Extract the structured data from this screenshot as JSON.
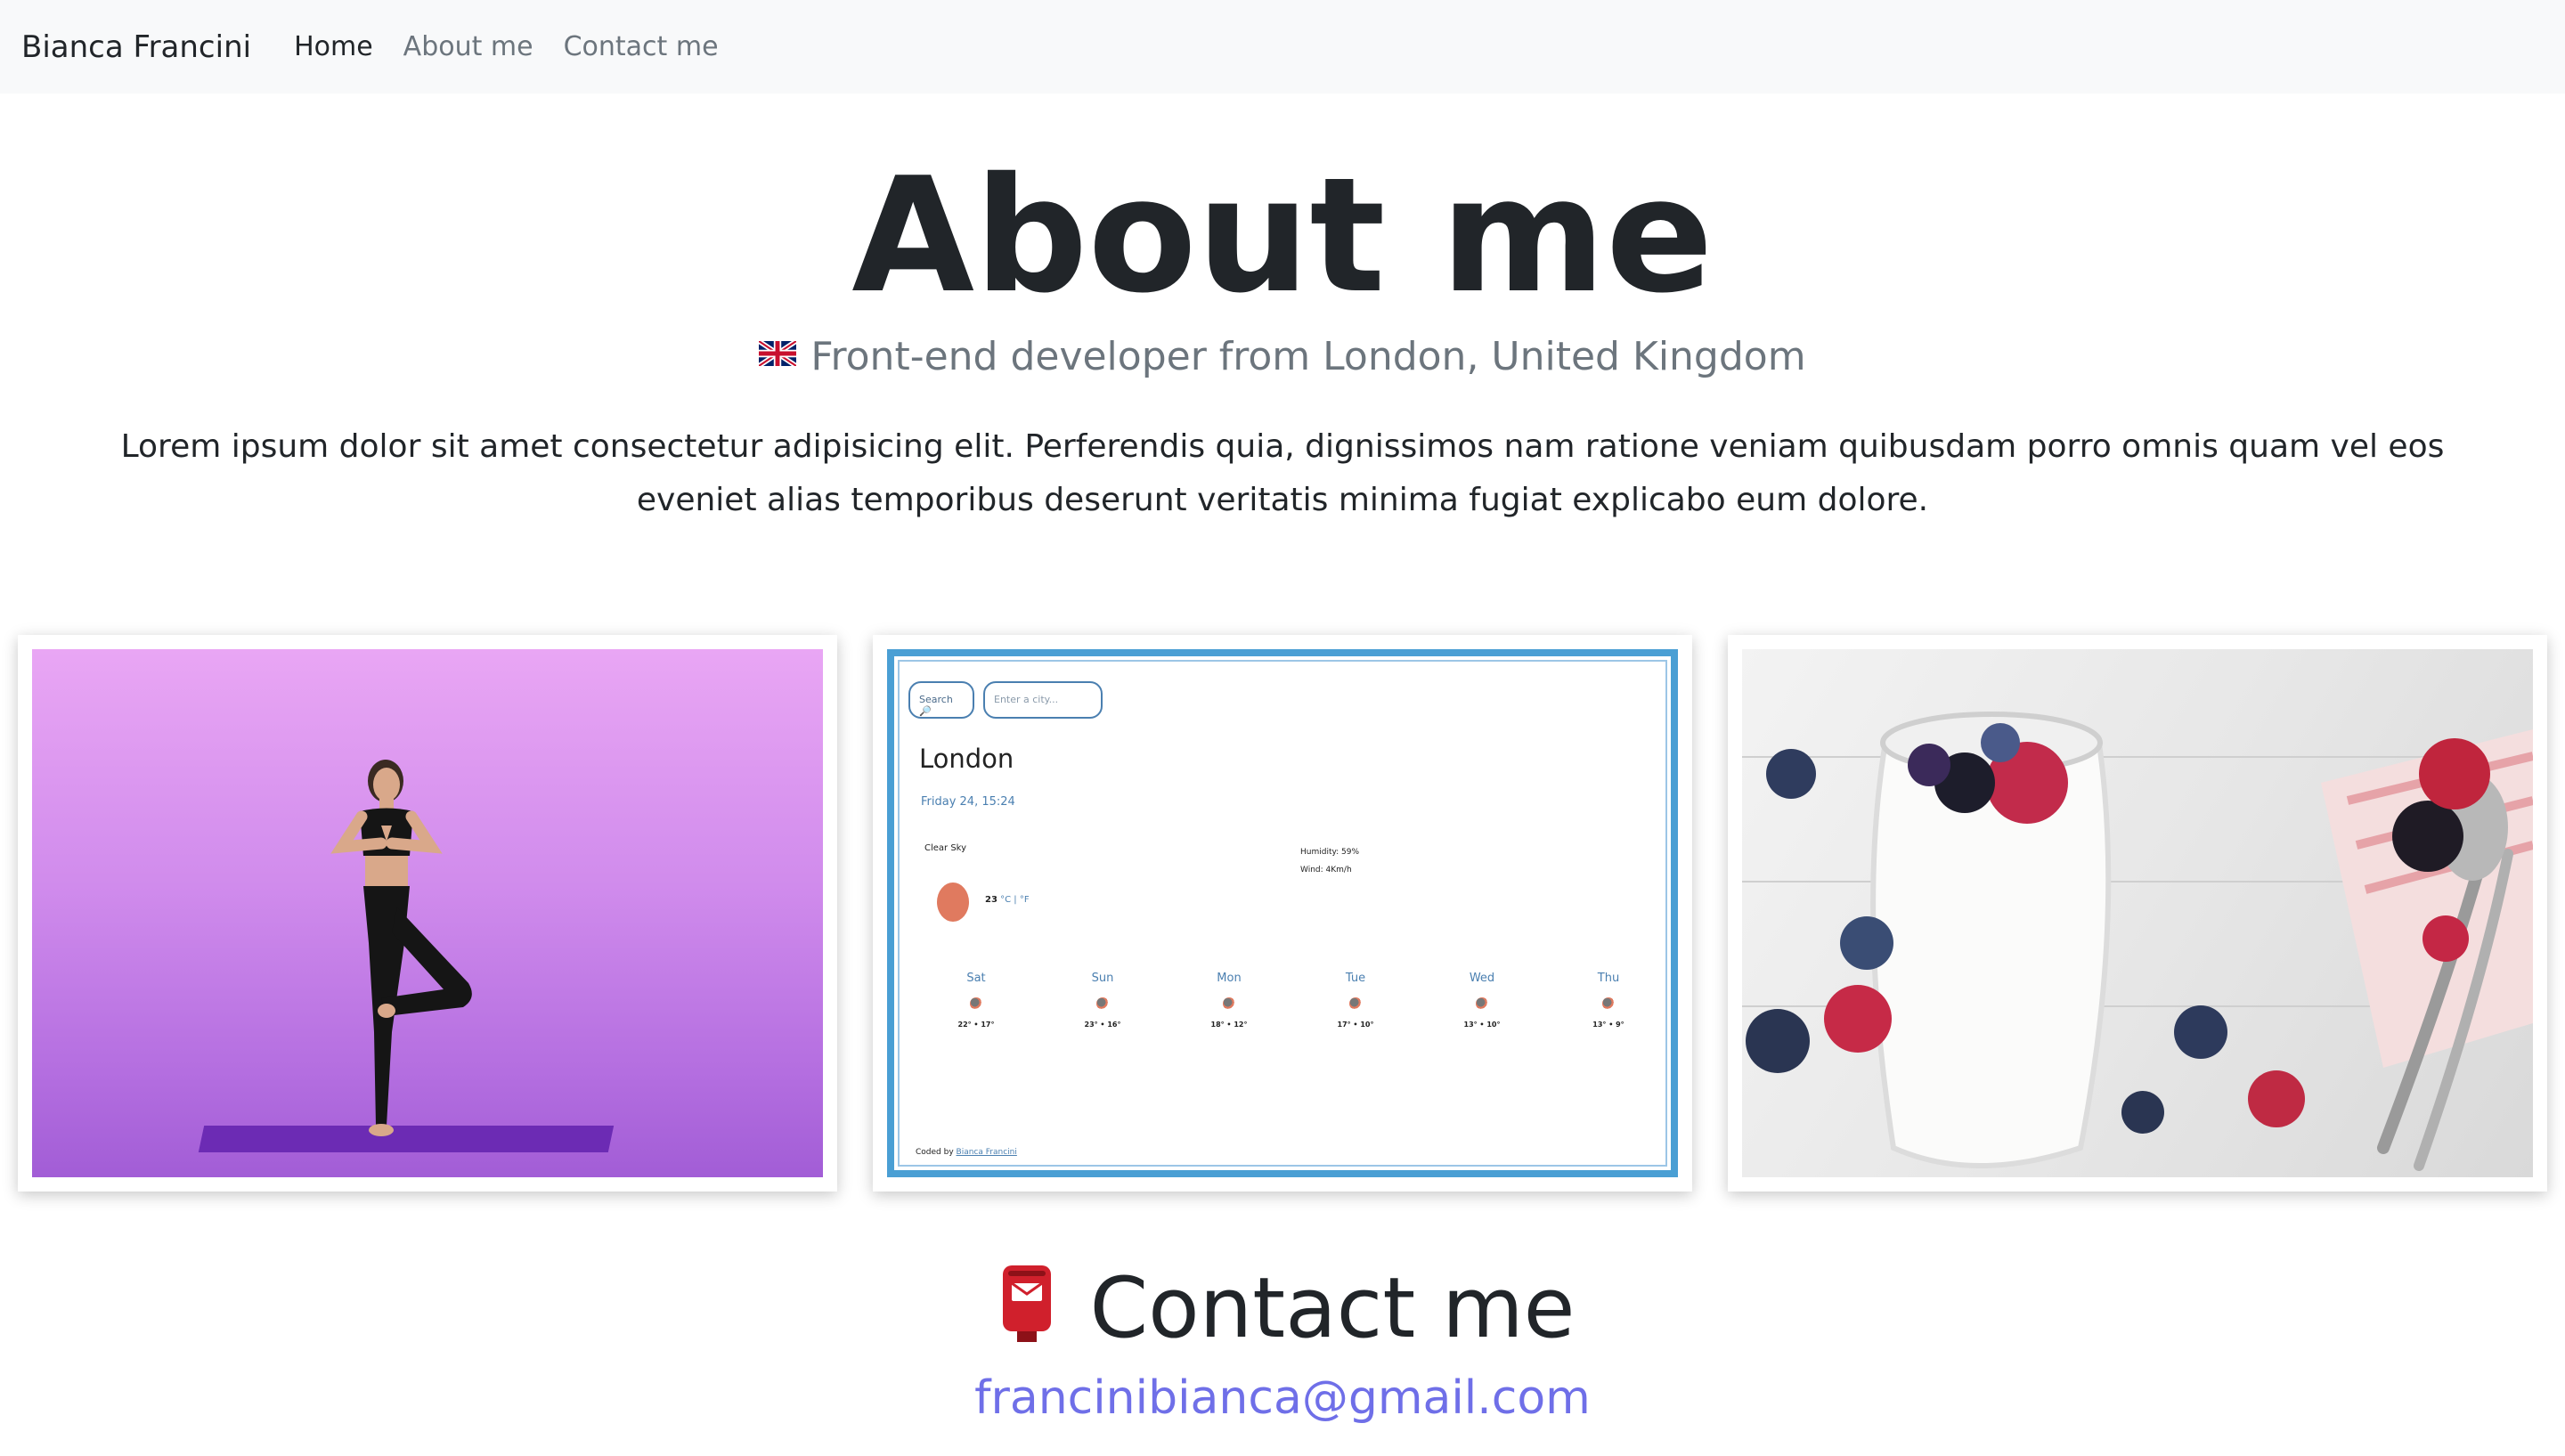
{
  "navbar": {
    "brand": "Bianca Francini",
    "links": [
      {
        "label": "Home",
        "active": true
      },
      {
        "label": "About me",
        "active": false
      },
      {
        "label": "Contact me",
        "active": false
      }
    ]
  },
  "about": {
    "title": "About me",
    "subtitle_flag_icon": "uk-flag-icon",
    "subtitle": "Front-end developer from London, United Kingdom",
    "lead": "Lorem ipsum dolor sit amet consectetur adipisicing elit. Perferendis quia, dignissimos nam ratione veniam quibusdam porro omnis quam vel eos eveniet alias temporibus deserunt veritatis minima fugiat explicabo eum dolore."
  },
  "gallery": {
    "weather_app": {
      "search_button": "Search 🔎",
      "city_placeholder": "Enter a city...",
      "city": "London",
      "date": "Friday 24, 15:24",
      "description": "Clear Sky",
      "temperature": "23",
      "units": "°C | °F",
      "humidity": "Humidity: 59%",
      "wind": "Wind: 4Km/h",
      "forecast": [
        {
          "day": "Sat",
          "range": "22° • 17°"
        },
        {
          "day": "Sun",
          "range": "23° • 16°"
        },
        {
          "day": "Mon",
          "range": "18° • 12°"
        },
        {
          "day": "Tue",
          "range": "17° • 10°"
        },
        {
          "day": "Wed",
          "range": "13° • 10°"
        },
        {
          "day": "Thu",
          "range": "13° • 9°"
        }
      ],
      "footer_prefix": "Coded by",
      "footer_link": "Bianca Francini"
    }
  },
  "contact": {
    "icon": "postbox-icon",
    "title": "Contact me",
    "email": "francinibianca@gmail.com"
  },
  "colors": {
    "navbar_bg": "#f8f9fa",
    "text": "#212529",
    "muted": "#6c757d",
    "link": "#6f6fe8",
    "yoga_bg": "#d08bec",
    "weather_border": "#4a9fd4"
  }
}
